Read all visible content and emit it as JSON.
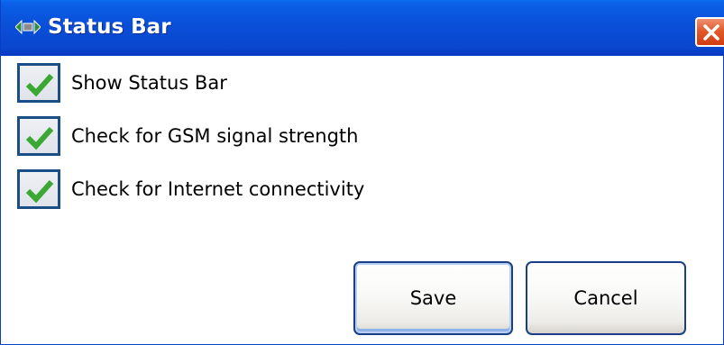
{
  "window": {
    "title": "Status Bar",
    "title_icon": "status-bar-icon",
    "close_icon": "close-icon"
  },
  "options": [
    {
      "label": "Show Status Bar",
      "checked": true
    },
    {
      "label": "Check for GSM signal strength",
      "checked": true
    },
    {
      "label": "Check for Internet connectivity",
      "checked": true
    }
  ],
  "buttons": {
    "save_label": "Save",
    "cancel_label": "Cancel"
  },
  "colors": {
    "titlebar": "#0a4fd8",
    "check_mark": "#3aa832",
    "checkbox_border": "#1a4f86",
    "close_button": "#e05a2a"
  }
}
